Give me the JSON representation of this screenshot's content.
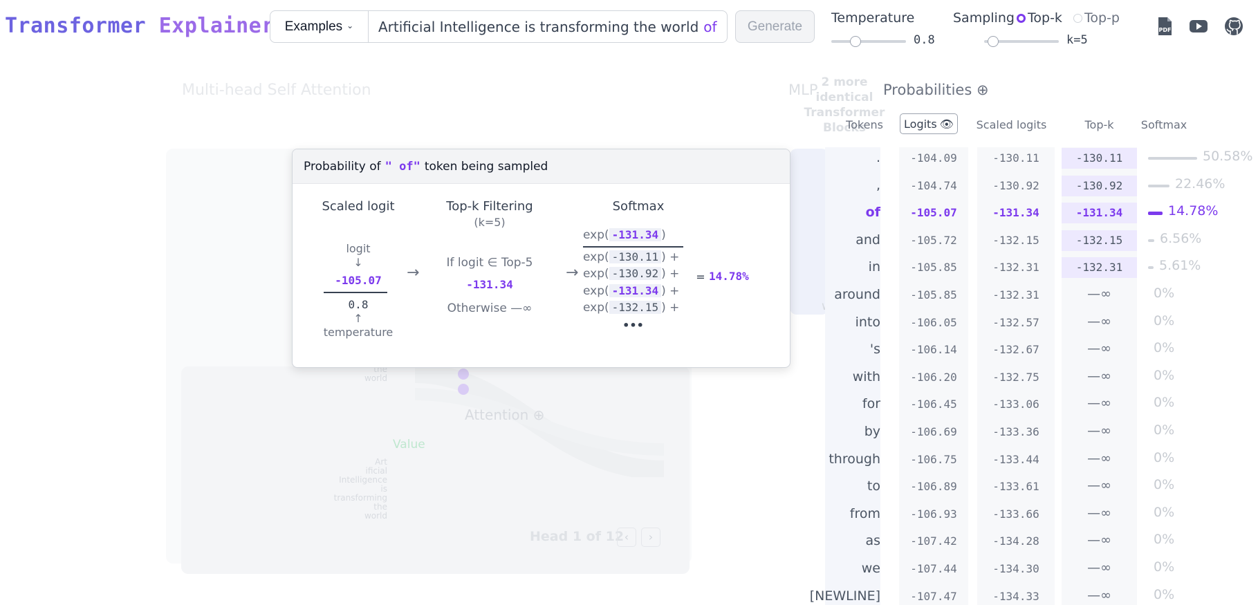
{
  "app": {
    "title_word1": "Transformer",
    "title_word2": "Explainer"
  },
  "header": {
    "examples_label": "Examples",
    "prompt_text": "Artificial Intelligence is transforming the world",
    "predicted_token": "of",
    "generate_label": "Generate",
    "temperature_label": "Temperature",
    "temperature_value": "0.8",
    "temperature_fraction": 0.32,
    "sampling_label": "Sampling",
    "topk_label": "Top-k",
    "topp_label": "Top-p",
    "k_value": "k=5",
    "k_fraction": 0.12
  },
  "background": {
    "mhsa_title": "Multi-head Self Attention",
    "attention_label": "Attention",
    "value_label": "Value",
    "head_label": "Head 1 of 12",
    "more_blocks": "2 more identical Transformer Blocks",
    "mlp_label": "MLP",
    "world_word": "world",
    "words": [
      "Art",
      "ificial",
      "Intelligence",
      "is",
      "transforming",
      "the",
      "world"
    ]
  },
  "probabilities": {
    "title": "Probabilities",
    "col_tokens": "Tokens",
    "col_logits": "Logits",
    "col_scaled": "Scaled logits",
    "col_topk": "Top-k",
    "col_softmax": "Softmax",
    "neg_inf": "—∞",
    "selected_index": 2,
    "rows": [
      {
        "token": ".",
        "logit": "-104.09",
        "scaled": "-130.11",
        "topk": "-130.11",
        "softmax": "50.58%",
        "p": 0.5058
      },
      {
        "token": ",",
        "logit": "-104.74",
        "scaled": "-130.92",
        "topk": "-130.92",
        "softmax": "22.46%",
        "p": 0.2246
      },
      {
        "token": "of",
        "logit": "-105.07",
        "scaled": "-131.34",
        "topk": "-131.34",
        "softmax": "14.78%",
        "p": 0.1478
      },
      {
        "token": "and",
        "logit": "-105.72",
        "scaled": "-132.15",
        "topk": "-132.15",
        "softmax": "6.56%",
        "p": 0.0656
      },
      {
        "token": "in",
        "logit": "-105.85",
        "scaled": "-132.31",
        "topk": "-132.31",
        "softmax": "5.61%",
        "p": 0.0561
      },
      {
        "token": "around",
        "logit": "-105.85",
        "scaled": "-132.31",
        "topk": "",
        "softmax": "0%",
        "p": 0
      },
      {
        "token": "into",
        "logit": "-106.05",
        "scaled": "-132.57",
        "topk": "",
        "softmax": "0%",
        "p": 0
      },
      {
        "token": "'s",
        "logit": "-106.14",
        "scaled": "-132.67",
        "topk": "",
        "softmax": "0%",
        "p": 0
      },
      {
        "token": "with",
        "logit": "-106.20",
        "scaled": "-132.75",
        "topk": "",
        "softmax": "0%",
        "p": 0
      },
      {
        "token": "for",
        "logit": "-106.45",
        "scaled": "-133.06",
        "topk": "",
        "softmax": "0%",
        "p": 0
      },
      {
        "token": "by",
        "logit": "-106.69",
        "scaled": "-133.36",
        "topk": "",
        "softmax": "0%",
        "p": 0
      },
      {
        "token": "through",
        "logit": "-106.75",
        "scaled": "-133.44",
        "topk": "",
        "softmax": "0%",
        "p": 0
      },
      {
        "token": "to",
        "logit": "-106.89",
        "scaled": "-133.61",
        "topk": "",
        "softmax": "0%",
        "p": 0
      },
      {
        "token": "from",
        "logit": "-106.93",
        "scaled": "-133.66",
        "topk": "",
        "softmax": "0%",
        "p": 0
      },
      {
        "token": "as",
        "logit": "-107.42",
        "scaled": "-134.28",
        "topk": "",
        "softmax": "0%",
        "p": 0
      },
      {
        "token": "we",
        "logit": "-107.44",
        "scaled": "-134.30",
        "topk": "",
        "softmax": "0%",
        "p": 0
      },
      {
        "token": "[NEWLINE]",
        "logit": "-107.47",
        "scaled": "-134.33",
        "topk": "",
        "softmax": "0%",
        "p": 0
      }
    ]
  },
  "tooltip": {
    "title_prefix": "Probability of",
    "token": "\" of\"",
    "title_suffix": "token being sampled",
    "scaled_logit_title": "Scaled logit",
    "logit_label": "logit",
    "logit_value": "-105.07",
    "temperature_value": "0.8",
    "temperature_label": "temperature",
    "topk_title": "Top-k Filtering",
    "topk_k": "(k=5)",
    "topk_condition": "If logit ∈ Top-5",
    "topk_value": "-131.34",
    "topk_otherwise": "Otherwise —∞",
    "softmax_title": "Softmax",
    "numerator": "-131.34",
    "denominator_terms": [
      "-130.11",
      "-130.92",
      "-131.34",
      "-132.15"
    ],
    "ellipsis": "•••",
    "equals": "=",
    "result": "14.78%"
  },
  "colors": {
    "accent": "#7c3aed",
    "logo": "#6d63e0",
    "topk_highlight": "#ede9fe"
  }
}
